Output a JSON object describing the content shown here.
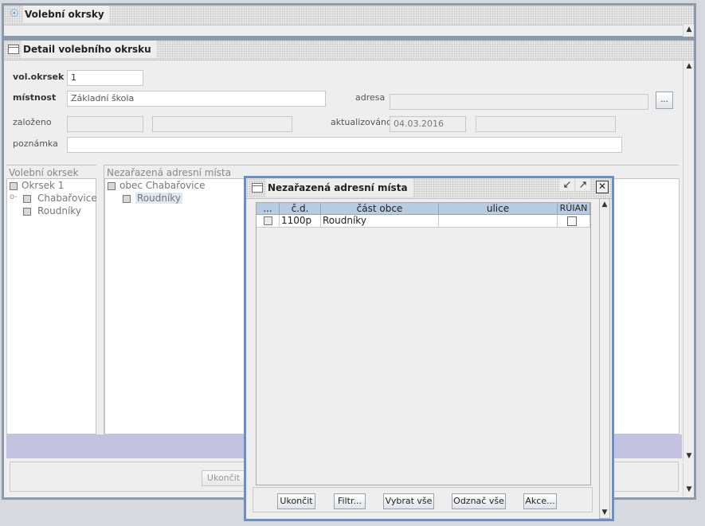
{
  "top_window": {
    "title": "Volební okrsky"
  },
  "detail_window": {
    "title": "Detail volebního okrsku",
    "form": {
      "vol_okrsek_label": "vol.okrsek",
      "vol_okrsek_value": "1",
      "mistnost_label": "místnost",
      "mistnost_value": "Základní škola",
      "adresa_label": "adresa",
      "adresa_button": "...",
      "zalozeno_label": "založeno",
      "aktualizovano_label": "aktualizováno",
      "aktualizovano_value": "04.03.2016",
      "poznamka_label": "poznámka"
    },
    "left_tree": {
      "header": "Volební okrsek",
      "root": "Okrsek 1",
      "children": [
        "Chabařovice",
        "Roudníky"
      ]
    },
    "right_tree": {
      "header": "Nezařazená adresní místa",
      "root": "obec Chabařovice",
      "child": "Roudníky"
    },
    "footer": {
      "close_button": "Ukončit"
    }
  },
  "dialog": {
    "title": "Nezařazená adresní místa",
    "table": {
      "columns": [
        "...",
        "č.d.",
        "část obce",
        "ulice",
        "RÚIAN"
      ],
      "rows": [
        {
          "cd": "1100p",
          "cast_obce": "Roudníky",
          "ulice": ""
        }
      ]
    },
    "buttons": {
      "close": "Ukončit",
      "filter": "Filtr...",
      "select_all": "Vybrat vše",
      "deselect_all": "Odznač vše",
      "actions": "Akce..."
    }
  }
}
